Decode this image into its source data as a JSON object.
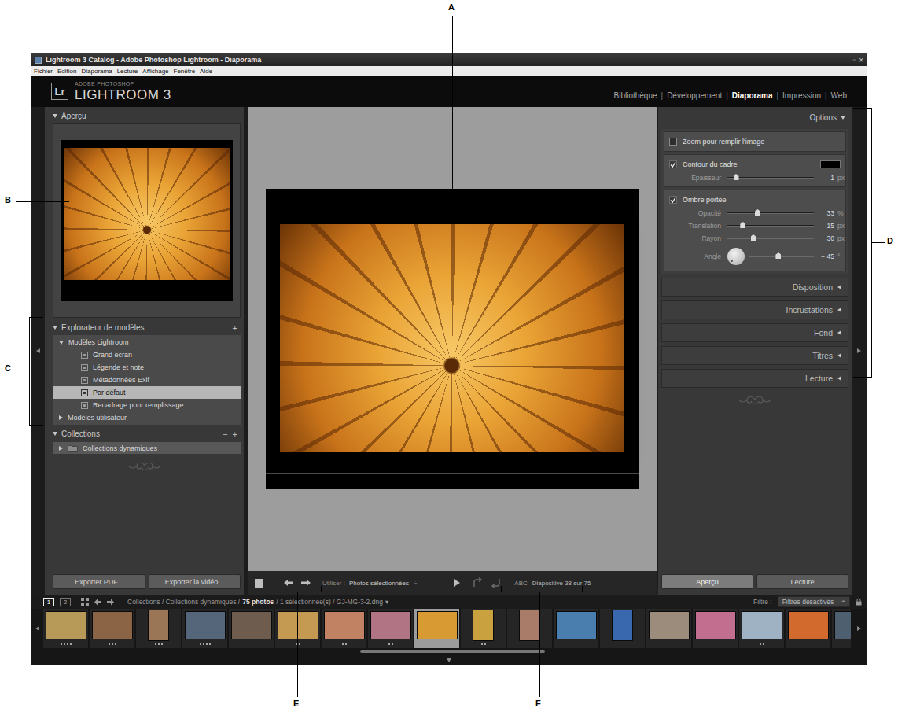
{
  "callouts": [
    {
      "label": "A"
    },
    {
      "label": "B"
    },
    {
      "label": "C"
    },
    {
      "label": "D"
    },
    {
      "label": "E"
    },
    {
      "label": "F"
    }
  ],
  "window": {
    "title": "Lightroom 3 Catalog - Adobe Photoshop Lightroom - Diaporama",
    "controls": [
      "–",
      "▫",
      "×"
    ]
  },
  "menu": [
    "Fichier",
    "Edition",
    "Diaporama",
    "Lecture",
    "Affichage",
    "Fenêtre",
    "Aide"
  ],
  "identity": {
    "logo": "Lr",
    "line1": "ADOBE PHOTOSHOP",
    "line2": "LIGHTROOM 3"
  },
  "modules": {
    "separator": "|",
    "items": [
      {
        "label": "Bibliothèque",
        "selected": false
      },
      {
        "label": "Développement",
        "selected": false
      },
      {
        "label": "Diaporama",
        "selected": true
      },
      {
        "label": "Impression",
        "selected": false
      },
      {
        "label": "Web",
        "selected": false
      }
    ]
  },
  "left_panel": {
    "preview": {
      "title": "Aperçu",
      "expanded": true
    },
    "templates": {
      "title": "Explorateur de modèles",
      "action": "+",
      "expanded": true,
      "folders": [
        {
          "label": "Modèles Lightroom",
          "expanded": true,
          "items": [
            {
              "label": "Grand écran",
              "selected": false
            },
            {
              "label": "Légende et note",
              "selected": false
            },
            {
              "label": "Métadonnées Exif",
              "selected": false
            },
            {
              "label": "Par défaut",
              "selected": true
            },
            {
              "label": "Recadrage pour remplissage",
              "selected": false
            }
          ]
        },
        {
          "label": "Modèles utilisateur",
          "expanded": false,
          "items": []
        }
      ]
    },
    "collections": {
      "title": "Collections",
      "expanded": true,
      "actions": [
        "−",
        "+"
      ],
      "items": [
        {
          "label": "Collections dynamiques",
          "expanded": false
        }
      ]
    },
    "buttons": [
      "Exporter PDF...",
      "Exporter la vidéo..."
    ]
  },
  "toolbar": {
    "use_label": "Utiliser :",
    "use_value": "Photos sélectionnées",
    "use_arrow": "÷",
    "abc": "ABC",
    "status": "Diapositive 38 sur 75"
  },
  "right_panel": {
    "options": {
      "title": "Options",
      "expanded": true,
      "groups": [
        {
          "rows": [
            {
              "kind": "checkbox",
              "label": "Zoom pour remplir l'image",
              "checked": false
            }
          ]
        },
        {
          "rows": [
            {
              "kind": "checkbox",
              "label": "Contour du cadre",
              "checked": true,
              "color": "#000000"
            },
            {
              "kind": "slider",
              "label": "Epaisseur",
              "level": 0.1,
              "reading": "1",
              "unit": "px"
            }
          ]
        },
        {
          "rows": [
            {
              "kind": "checkbox",
              "label": "Ombre portée",
              "checked": true
            },
            {
              "kind": "slider",
              "label": "Opacité",
              "level": 0.35,
              "reading": "33",
              "unit": "%"
            },
            {
              "kind": "slider",
              "label": "Translation",
              "level": 0.18,
              "reading": "15",
              "unit": "px"
            },
            {
              "kind": "slider",
              "label": "Rayon",
              "level": 0.3,
              "reading": "30",
              "unit": "px"
            },
            {
              "kind": "angle",
              "label": "Angle",
              "level": 0.45,
              "reading": "− 45",
              "unit": "°"
            }
          ]
        }
      ]
    },
    "sections": [
      {
        "title": "Disposition",
        "expanded": false
      },
      {
        "title": "Incrustations",
        "expanded": false
      },
      {
        "title": "Fond",
        "expanded": false
      },
      {
        "title": "Titres",
        "expanded": false
      },
      {
        "title": "Lecture",
        "expanded": false
      }
    ],
    "buttons": [
      "Aperçu",
      "Lecture"
    ]
  },
  "filmstrip": {
    "pages": [
      {
        "label": "1",
        "selected": true
      },
      {
        "label": "2",
        "selected": false
      }
    ],
    "path": "Collections / Collections dynamiques /",
    "count": "75 photos",
    "selection": "/ 1 sélectionnée(s) / GJ-MG-3-2.dng",
    "path_arrow": "▾",
    "filter_label": "Filtre :",
    "filter_value": "Filtres désactivés",
    "filter_arrow": "÷",
    "thumbnails": [
      {
        "kind": "landscape",
        "color": "#b89a58",
        "stars": 4,
        "selected": false
      },
      {
        "kind": "landscape",
        "color": "#8a6444",
        "stars": 3,
        "selected": false
      },
      {
        "kind": "portrait",
        "color": "#9a7656",
        "stars": 3,
        "selected": false
      },
      {
        "kind": "landscape",
        "color": "#56667a",
        "stars": 4,
        "selected": false
      },
      {
        "kind": "landscape",
        "color": "#6e5c4e",
        "stars": 0,
        "selected": false
      },
      {
        "kind": "landscape",
        "color": "#c49a52",
        "stars": 2,
        "selected": false
      },
      {
        "kind": "landscape",
        "color": "#c08262",
        "stars": 2,
        "selected": false
      },
      {
        "kind": "landscape",
        "color": "#b07484",
        "stars": 2,
        "selected": false
      },
      {
        "kind": "landscape",
        "color": "#d89a32",
        "stars": 0,
        "selected": true
      },
      {
        "kind": "portrait",
        "color": "#c9a13e",
        "stars": 2,
        "selected": false
      },
      {
        "kind": "portrait",
        "color": "#a97c6a",
        "stars": 0,
        "selected": false
      },
      {
        "kind": "landscape",
        "color": "#4a7eae",
        "stars": 0,
        "selected": false
      },
      {
        "kind": "portrait",
        "color": "#3a68ae",
        "stars": 0,
        "selected": false
      },
      {
        "kind": "landscape",
        "color": "#9c8c7c",
        "stars": 0,
        "selected": false
      },
      {
        "kind": "landscape",
        "color": "#c26e8e",
        "stars": 0,
        "selected": false
      },
      {
        "kind": "landscape",
        "color": "#9fb2c4",
        "stars": 2,
        "selected": false
      },
      {
        "kind": "landscape",
        "color": "#d26a2e",
        "stars": 0,
        "selected": false
      },
      {
        "kind": "landscape",
        "color": "#4e6070",
        "stars": 0,
        "selected": false
      }
    ]
  }
}
